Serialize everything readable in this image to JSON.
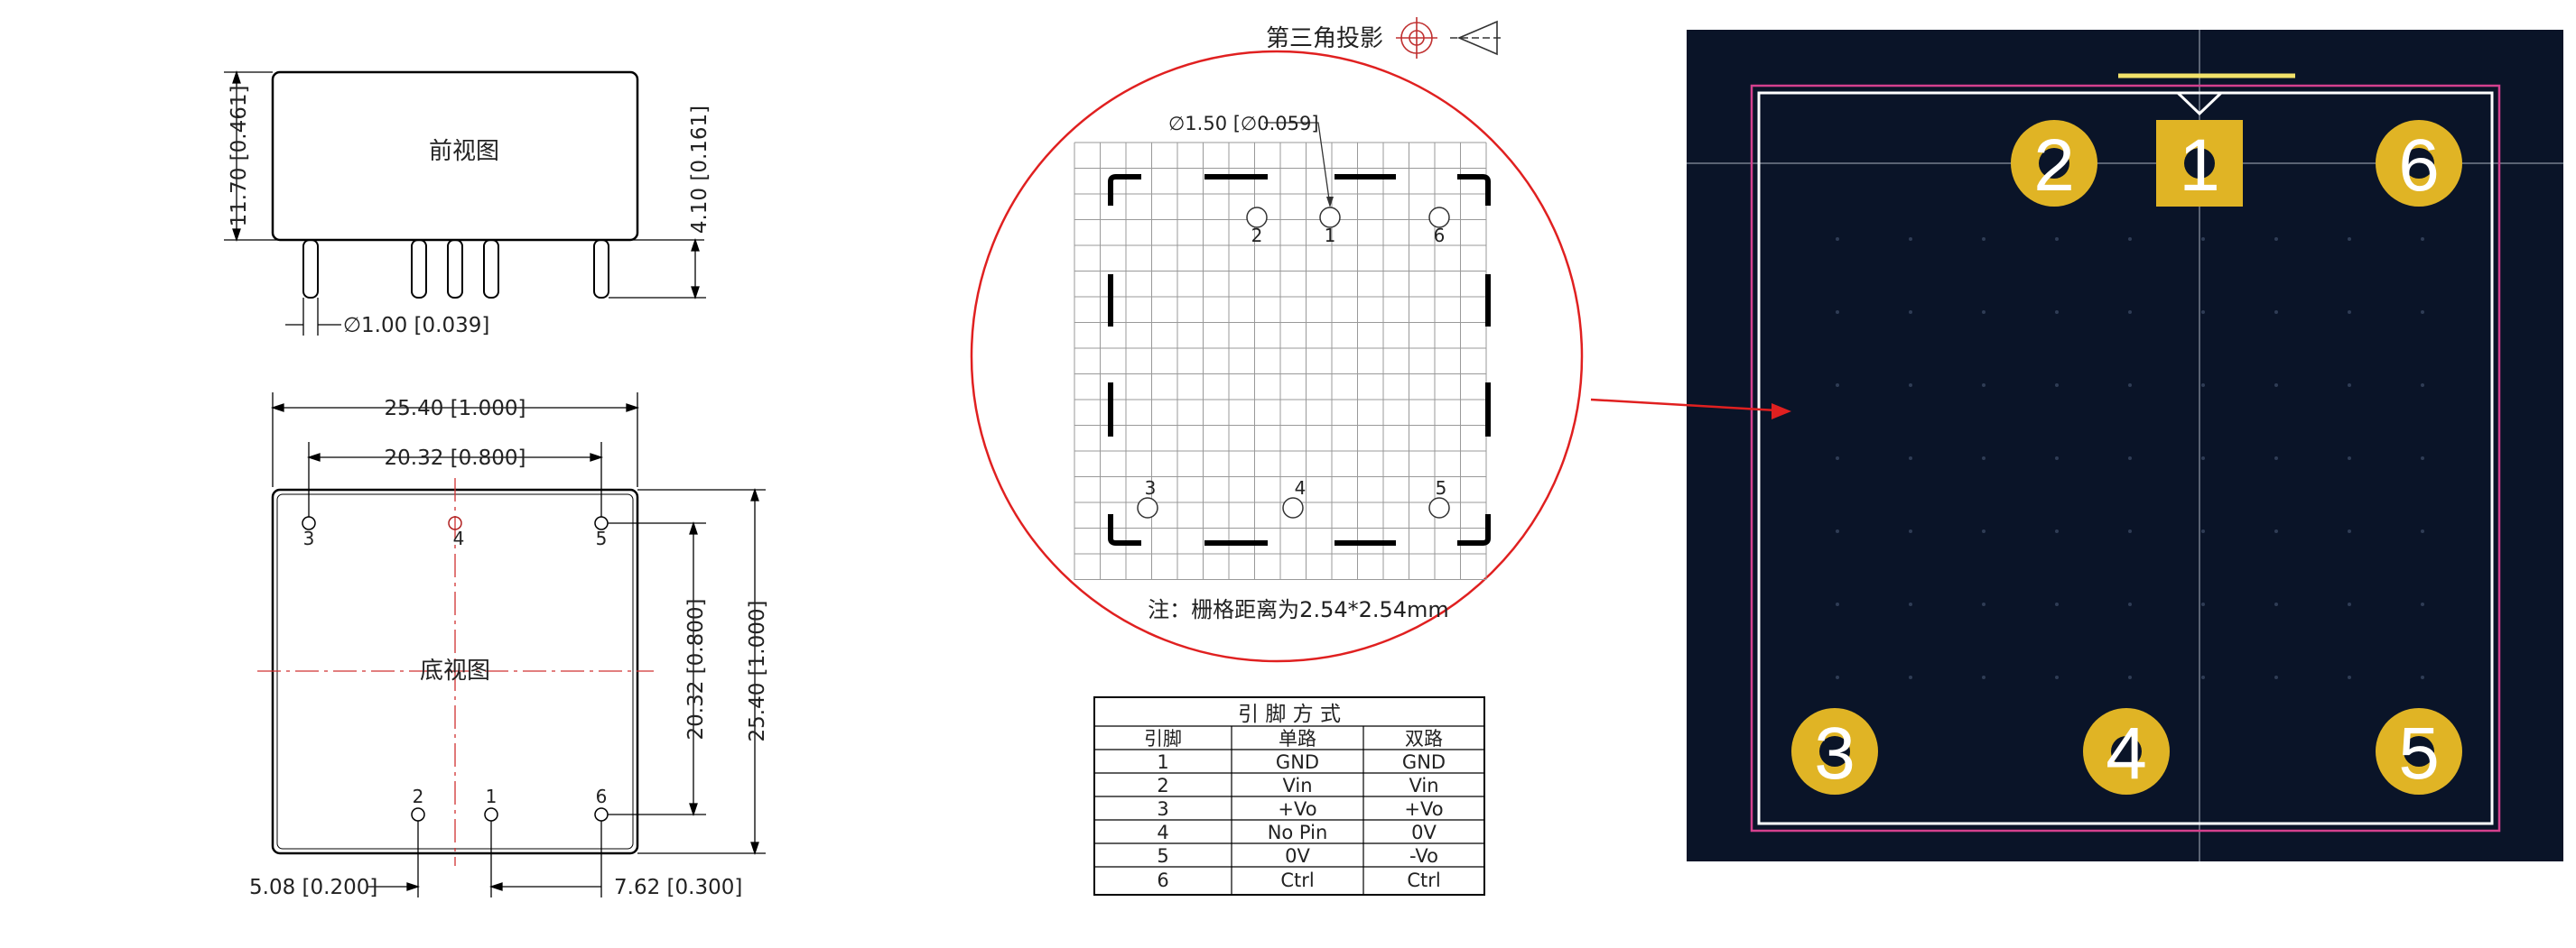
{
  "front_view": {
    "title": "前视图",
    "height_dim": "11.70 [0.461]",
    "pin_length_dim": "4.10 [0.161]",
    "pin_diameter_dim": "∅1.00 [0.039]"
  },
  "bottom_view": {
    "title": "底视图",
    "width_dim": "25.40 [1.000]",
    "pin_span_dim": "20.32 [0.800]",
    "height_dim": "25.40 [1.000]",
    "pin_vspan_dim": "20.32 [0.800]",
    "left_offset_dim": "5.08 [0.200]",
    "right_offset_dim": "7.62 [0.300]",
    "pins_top": [
      "3",
      "4",
      "5"
    ],
    "pins_bottom": [
      "2",
      "1",
      "6"
    ]
  },
  "projection": {
    "label": "第三角投影",
    "icons": [
      "circle-target-icon",
      "cone-icon"
    ]
  },
  "grid_detail": {
    "hole_dim": "∅1.50 [∅0.059]",
    "pins_top": [
      "2",
      "1",
      "6"
    ],
    "pins_bottom": [
      "3",
      "4",
      "5"
    ],
    "note": "注：栅格距离为2.54*2.54mm"
  },
  "pin_table": {
    "title": "引 脚 方 式",
    "headers": [
      "引脚",
      "单路",
      "双路"
    ],
    "rows": [
      [
        "1",
        "GND",
        "GND"
      ],
      [
        "2",
        "Vin",
        "Vin"
      ],
      [
        "3",
        "+Vo",
        "+Vo"
      ],
      [
        "4",
        "No Pin",
        "0V"
      ],
      [
        "5",
        "0V",
        "-Vo"
      ],
      [
        "6",
        "Ctrl",
        "Ctrl"
      ]
    ]
  },
  "pcb": {
    "pads_top": [
      "2",
      "1",
      "6"
    ],
    "pads_bottom": [
      "3",
      "4",
      "5"
    ],
    "colors": {
      "background": "#0a1428",
      "pad": "#e0b425",
      "outline": "#ffffff",
      "outline_inner": "#d4418e",
      "marker": "#f2e26a",
      "pointer": "#e02020"
    }
  }
}
